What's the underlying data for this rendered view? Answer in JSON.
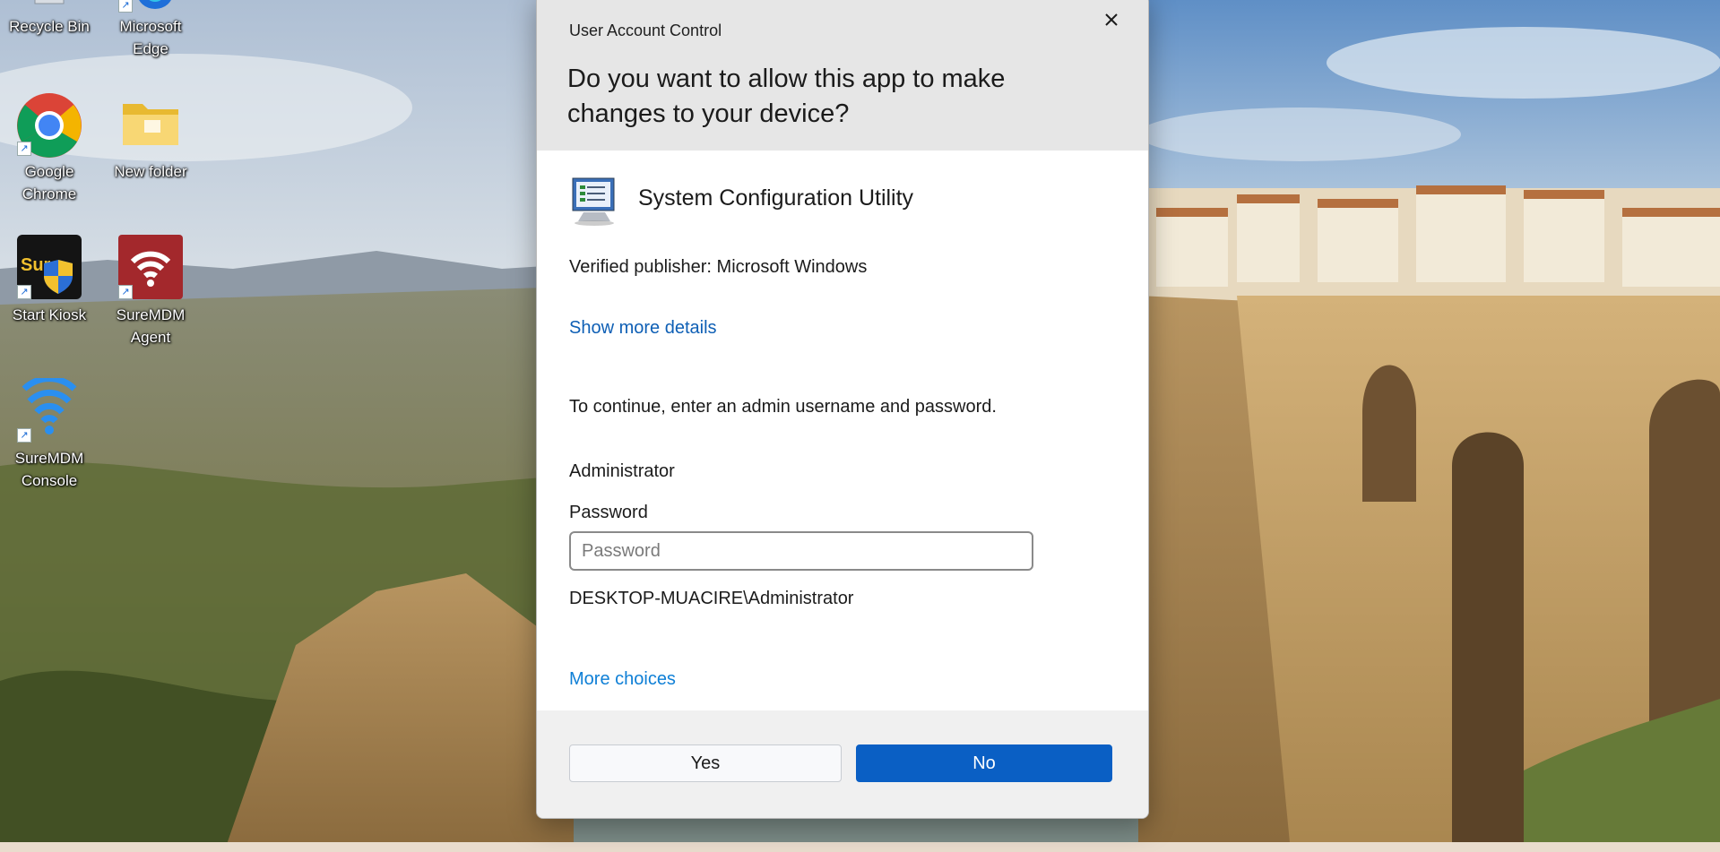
{
  "desktop": {
    "icons": [
      {
        "label": "Recycle Bin",
        "icon": "recycle-bin-icon"
      },
      {
        "label": "Microsoft\nEdge",
        "icon": "edge-icon"
      },
      {
        "label": "Google\nChrome",
        "icon": "chrome-icon"
      },
      {
        "label": "New folder",
        "icon": "folder-icon"
      },
      {
        "label": "Start Kiosk",
        "icon": "surelock-kiosk-icon"
      },
      {
        "label": "SureMDM\nAgent",
        "icon": "suremdm-agent-icon"
      },
      {
        "label": "SureMDM\nConsole",
        "icon": "suremdm-console-icon"
      }
    ],
    "kiosk_badge_text": "Sure"
  },
  "uac": {
    "caption": "User Account Control",
    "question": "Do you want to allow this app to make changes to your device?",
    "app_name": "System Configuration Utility",
    "publisher": "Verified publisher: Microsoft Windows",
    "show_more_details": "Show more details",
    "continue_text": "To continue, enter an admin username and password.",
    "username": "Administrator",
    "password_label": "Password",
    "password_placeholder": "Password",
    "password_value": "",
    "domain_user": "DESKTOP-MUACIRE\\Administrator",
    "more_choices": "More choices",
    "yes_label": "Yes",
    "no_label": "No",
    "accent_color": "#0a5fc4",
    "link_color": "#0e5fb5"
  }
}
